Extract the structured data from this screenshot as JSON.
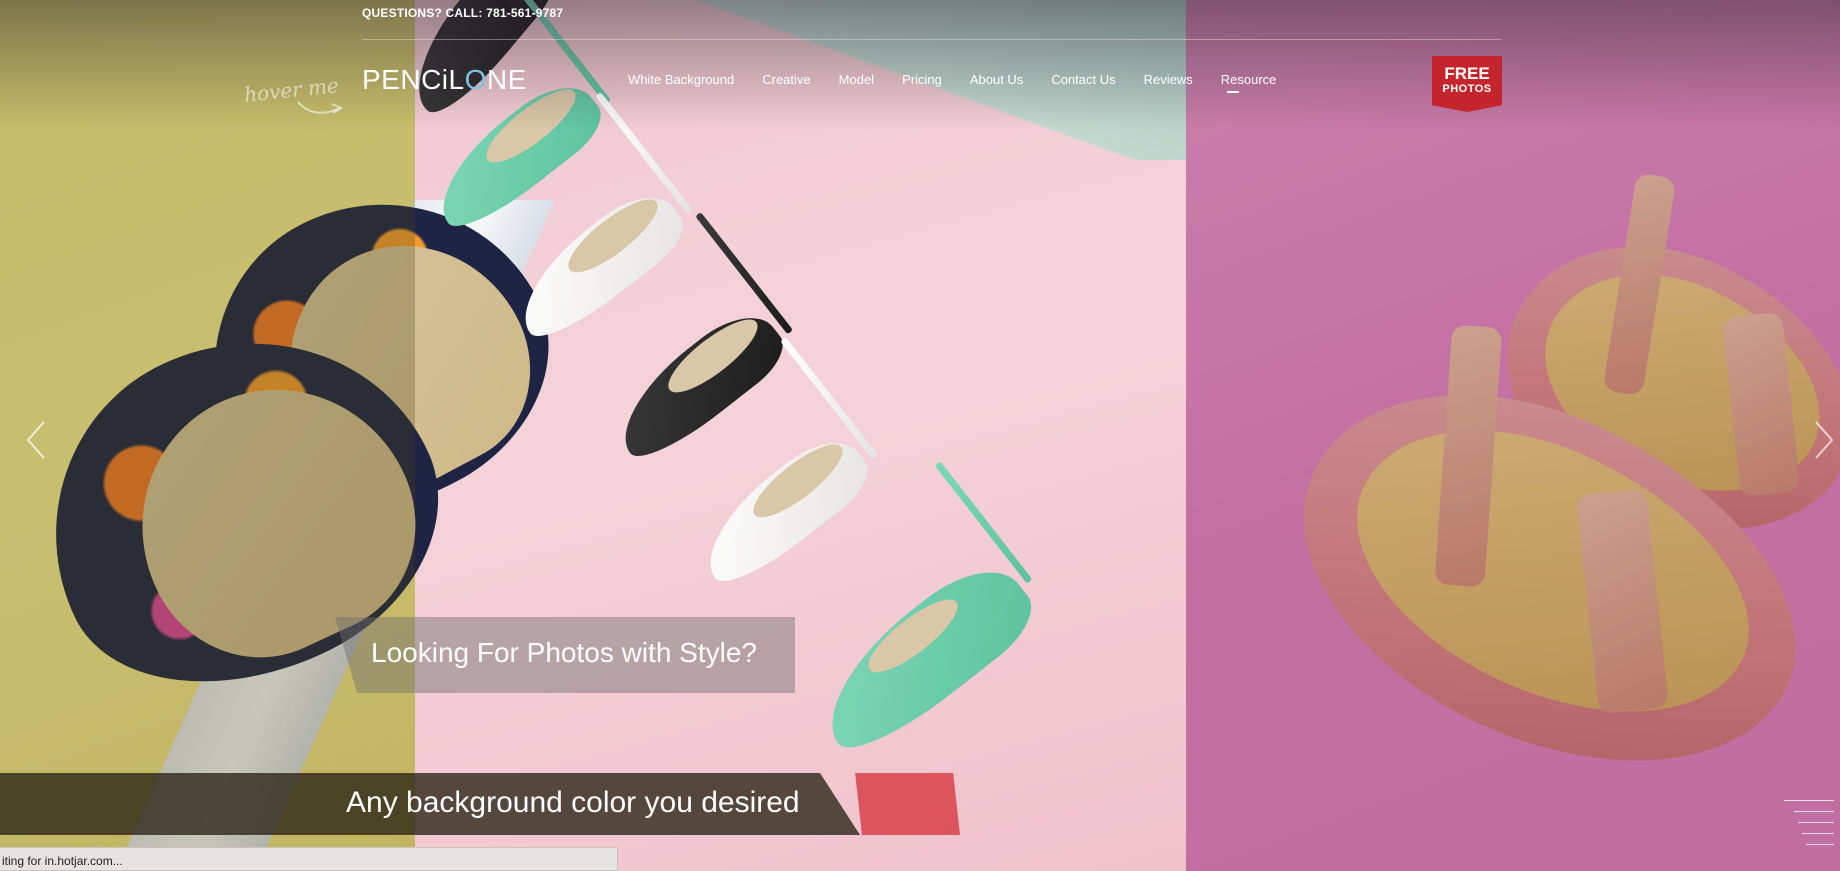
{
  "header": {
    "phone_prefix": "QUESTIONS? CALL:",
    "phone_number": "781-561-9787",
    "logo": {
      "part1": "PENCiL",
      "part2": "O",
      "part3": "NE"
    },
    "nav": [
      {
        "label": "White Background"
      },
      {
        "label": "Creative"
      },
      {
        "label": "Model"
      },
      {
        "label": "Pricing"
      },
      {
        "label": "About Us"
      },
      {
        "label": "Contact Us"
      },
      {
        "label": "Reviews"
      },
      {
        "label": "Resource"
      }
    ],
    "free_button": {
      "line1": "FREE",
      "line2": "PHOTOS"
    }
  },
  "slider": {
    "hint": "hover me",
    "caption_primary": "Looking For Photos with Style?",
    "caption_secondary": "Any background color you desired",
    "accent_color": "#c4252c"
  },
  "browser": {
    "status_text": "iting for in.hotjar.com..."
  }
}
